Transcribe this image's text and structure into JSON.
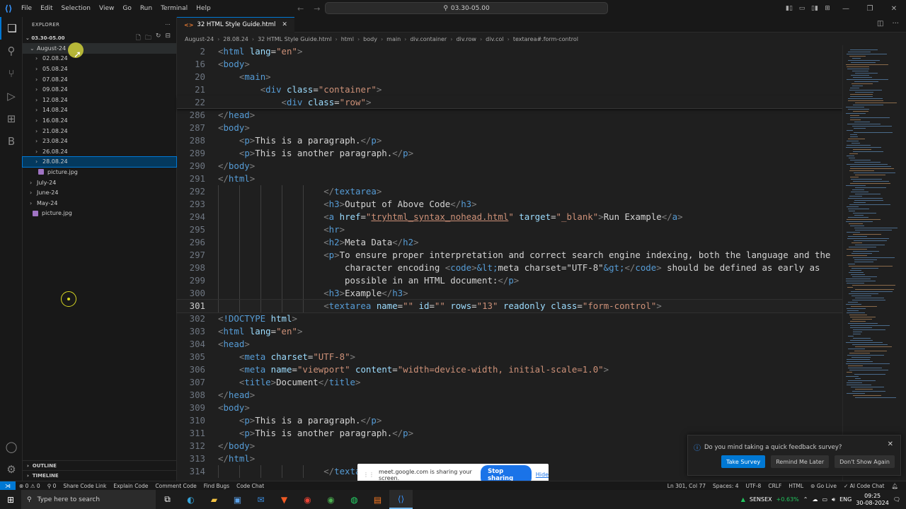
{
  "titlebar": {
    "menu": [
      "File",
      "Edit",
      "Selection",
      "View",
      "Go",
      "Run",
      "Terminal",
      "Help"
    ],
    "search_text": "03.30-05.00"
  },
  "sidebar": {
    "header": "EXPLORER",
    "root_folder": "03.30-05.00",
    "tree": [
      {
        "label": "August-24",
        "level": 0,
        "type": "folder",
        "open": true
      },
      {
        "label": "02.08.24",
        "level": 1,
        "type": "folder"
      },
      {
        "label": "05.08.24",
        "level": 1,
        "type": "folder"
      },
      {
        "label": "07.08.24",
        "level": 1,
        "type": "folder"
      },
      {
        "label": "09.08.24",
        "level": 1,
        "type": "folder"
      },
      {
        "label": "12.08.24",
        "level": 1,
        "type": "folder"
      },
      {
        "label": "14.08.24",
        "level": 1,
        "type": "folder"
      },
      {
        "label": "16.08.24",
        "level": 1,
        "type": "folder"
      },
      {
        "label": "21.08.24",
        "level": 1,
        "type": "folder"
      },
      {
        "label": "23.08.24",
        "level": 1,
        "type": "folder"
      },
      {
        "label": "26.08.24",
        "level": 1,
        "type": "folder"
      },
      {
        "label": "28.08.24",
        "level": 1,
        "type": "folder",
        "selected": true
      },
      {
        "label": "picture.jpg",
        "level": 1,
        "type": "file"
      },
      {
        "label": "July-24",
        "level": 0,
        "type": "folder"
      },
      {
        "label": "June-24",
        "level": 0,
        "type": "folder"
      },
      {
        "label": "May-24",
        "level": 0,
        "type": "folder"
      },
      {
        "label": "picture.jpg",
        "level": 0,
        "type": "file"
      }
    ],
    "outline": "OUTLINE",
    "timeline": "TIMELINE"
  },
  "editor": {
    "tab_label": "32 HTML Style Guide.html",
    "breadcrumb": [
      "August-24",
      "28.08.24",
      "32 HTML Style Guide.html",
      "html",
      "body",
      "main",
      "div.container",
      "div.row",
      "div.col",
      "textarea#.form-control"
    ]
  },
  "code_lines": [
    {
      "n": "2",
      "html": "<span class='t-br'>&lt;</span><span class='t-tag'>html</span> <span class='t-attr'>lang</span><span class='t-txt'>=</span><span class='t-val'>\"en\"</span><span class='t-br'>&gt;</span>",
      "sticky": true
    },
    {
      "n": "16",
      "html": "<span class='t-br'>&lt;</span><span class='t-tag'>body</span><span class='t-br'>&gt;</span>",
      "sticky": true
    },
    {
      "n": "20",
      "html": "    <span class='t-br'>&lt;</span><span class='t-tag'>main</span><span class='t-br'>&gt;</span>",
      "sticky": true
    },
    {
      "n": "21",
      "html": "        <span class='t-br'>&lt;</span><span class='t-tag'>div</span> <span class='t-attr'>class</span><span class='t-txt'>=</span><span class='t-val'>\"container\"</span><span class='t-br'>&gt;</span>",
      "sticky": true
    },
    {
      "n": "22",
      "html": "            <span class='t-br'>&lt;</span><span class='t-tag'>div</span> <span class='t-attr'>class</span><span class='t-txt'>=</span><span class='t-val'>\"row\"</span><span class='t-br'>&gt;</span>",
      "sticky": true,
      "last_sticky": true
    },
    {
      "n": "286",
      "html": "<span class='t-br'>&lt;/</span><span class='t-tag'>head</span><span class='t-br'>&gt;</span>"
    },
    {
      "n": "287",
      "html": "<span class='t-br'>&lt;</span><span class='t-tag'>body</span><span class='t-br'>&gt;</span>"
    },
    {
      "n": "288",
      "html": "    <span class='t-br'>&lt;</span><span class='t-tag'>p</span><span class='t-br'>&gt;</span><span class='t-txt'>This is a paragraph.</span><span class='t-br'>&lt;/</span><span class='t-tag'>p</span><span class='t-br'>&gt;</span>"
    },
    {
      "n": "289",
      "html": "    <span class='t-br'>&lt;</span><span class='t-tag'>p</span><span class='t-br'>&gt;</span><span class='t-txt'>This is another paragraph.</span><span class='t-br'>&lt;/</span><span class='t-tag'>p</span><span class='t-br'>&gt;</span>"
    },
    {
      "n": "290",
      "html": "<span class='t-br'>&lt;/</span><span class='t-tag'>body</span><span class='t-br'>&gt;</span>"
    },
    {
      "n": "291",
      "html": "<span class='t-br'>&lt;/</span><span class='t-tag'>html</span><span class='t-br'>&gt;</span>"
    },
    {
      "n": "292",
      "html": "                    <span class='t-br'>&lt;/</span><span class='t-tag'>textarea</span><span class='t-br'>&gt;</span>",
      "guides": true
    },
    {
      "n": "293",
      "html": "                    <span class='t-br'>&lt;</span><span class='t-tag'>h3</span><span class='t-br'>&gt;</span><span class='t-txt'>Output of Above Code</span><span class='t-br'>&lt;/</span><span class='t-tag'>h3</span><span class='t-br'>&gt;</span>",
      "guides": true
    },
    {
      "n": "294",
      "html": "                    <span class='t-br'>&lt;</span><span class='t-tag'>a</span> <span class='t-attr'>href</span><span class='t-txt'>=</span><span class='t-val'>\"<u>tryhtml_syntax_nohead.html</u>\"</span> <span class='t-attr'>target</span><span class='t-txt'>=</span><span class='t-val'>\"_blank\"</span><span class='t-br'>&gt;</span><span class='t-txt'>Run Example</span><span class='t-br'>&lt;/</span><span class='t-tag'>a</span><span class='t-br'>&gt;</span>",
      "guides": true
    },
    {
      "n": "295",
      "html": "                    <span class='t-br'>&lt;</span><span class='t-tag'>hr</span><span class='t-br'>&gt;</span>",
      "guides": true
    },
    {
      "n": "296",
      "html": "                    <span class='t-br'>&lt;</span><span class='t-tag'>h2</span><span class='t-br'>&gt;</span><span class='t-txt'>Meta Data</span><span class='t-br'>&lt;/</span><span class='t-tag'>h2</span><span class='t-br'>&gt;</span>",
      "guides": true
    },
    {
      "n": "297",
      "html": "                    <span class='t-br'>&lt;</span><span class='t-tag'>p</span><span class='t-br'>&gt;</span><span class='t-txt'>To ensure proper interpretation and correct search engine indexing, both the language and the</span>",
      "guides": true
    },
    {
      "n": "298",
      "html": "                        <span class='t-txt'>character encoding </span><span class='t-br'>&lt;</span><span class='t-tag'>code</span><span class='t-br'>&gt;</span><span class='t-ent'>&amp;lt;</span><span class='t-txt'>meta charset=\"UTF-8\"</span><span class='t-ent'>&amp;gt;</span><span class='t-br'>&lt;/</span><span class='t-tag'>code</span><span class='t-br'>&gt;</span><span class='t-txt'> should be defined as early as</span>",
      "guides": true
    },
    {
      "n": "299",
      "html": "                        <span class='t-txt'>possible in an HTML document:</span><span class='t-br'>&lt;/</span><span class='t-tag'>p</span><span class='t-br'>&gt;</span>",
      "guides": true
    },
    {
      "n": "300",
      "html": "                    <span class='t-br'>&lt;</span><span class='t-tag'>h3</span><span class='t-br'>&gt;</span><span class='t-txt'>Example</span><span class='t-br'>&lt;/</span><span class='t-tag'>h3</span><span class='t-br'>&gt;</span>",
      "guides": true
    },
    {
      "n": "301",
      "html": "                    <span class='t-br'>&lt;</span><span class='t-tag'>textarea</span> <span class='t-attr'>name</span><span class='t-txt'>=</span><span class='t-val'>\"\"</span> <span class='t-attr'>id</span><span class='t-txt'>=</span><span class='t-val'>\"\"</span> <span class='t-attr'>rows</span><span class='t-txt'>=</span><span class='t-val'>\"13\"</span> <span class='t-attr'>readonly</span> <span class='t-attr'>class</span><span class='t-txt'>=</span><span class='t-val'>\"form-control\"</span><span class='t-br'>&gt;</span>",
      "guides": true,
      "current": true
    },
    {
      "n": "302",
      "html": "<span class='t-br'>&lt;</span><span class='t-tag'>!DOCTYPE</span> <span class='t-attr'>html</span><span class='t-br'>&gt;</span>"
    },
    {
      "n": "303",
      "html": "<span class='t-br'>&lt;</span><span class='t-tag'>html</span> <span class='t-attr'>lang</span><span class='t-txt'>=</span><span class='t-val'>\"en\"</span><span class='t-br'>&gt;</span>"
    },
    {
      "n": "304",
      "html": "<span class='t-br'>&lt;</span><span class='t-tag'>head</span><span class='t-br'>&gt;</span>"
    },
    {
      "n": "305",
      "html": "    <span class='t-br'>&lt;</span><span class='t-tag'>meta</span> <span class='t-attr'>charset</span><span class='t-txt'>=</span><span class='t-val'>\"UTF-8\"</span><span class='t-br'>&gt;</span>"
    },
    {
      "n": "306",
      "html": "    <span class='t-br'>&lt;</span><span class='t-tag'>meta</span> <span class='t-attr'>name</span><span class='t-txt'>=</span><span class='t-val'>\"viewport\"</span> <span class='t-attr'>content</span><span class='t-txt'>=</span><span class='t-val'>\"width=device-width, initial-scale=1.0\"</span><span class='t-br'>&gt;</span>"
    },
    {
      "n": "307",
      "html": "    <span class='t-br'>&lt;</span><span class='t-tag'>title</span><span class='t-br'>&gt;</span><span class='t-txt'>Document</span><span class='t-br'>&lt;/</span><span class='t-tag'>title</span><span class='t-br'>&gt;</span>"
    },
    {
      "n": "308",
      "html": "<span class='t-br'>&lt;/</span><span class='t-tag'>head</span><span class='t-br'>&gt;</span>"
    },
    {
      "n": "309",
      "html": "<span class='t-br'>&lt;</span><span class='t-tag'>body</span><span class='t-br'>&gt;</span>"
    },
    {
      "n": "310",
      "html": "    <span class='t-br'>&lt;</span><span class='t-tag'>p</span><span class='t-br'>&gt;</span><span class='t-txt'>This is a paragraph.</span><span class='t-br'>&lt;/</span><span class='t-tag'>p</span><span class='t-br'>&gt;</span>"
    },
    {
      "n": "311",
      "html": "    <span class='t-br'>&lt;</span><span class='t-tag'>p</span><span class='t-br'>&gt;</span><span class='t-txt'>This is another paragraph.</span><span class='t-br'>&lt;/</span><span class='t-tag'>p</span><span class='t-br'>&gt;</span>"
    },
    {
      "n": "312",
      "html": "<span class='t-br'>&lt;/</span><span class='t-tag'>body</span><span class='t-br'>&gt;</span>"
    },
    {
      "n": "313",
      "html": "<span class='t-br'>&lt;/</span><span class='t-tag'>html</span><span class='t-br'>&gt;</span>"
    },
    {
      "n": "314",
      "html": "                    <span class='t-br'>&lt;/</span><span class='t-tag'>texta</span>",
      "guides": true
    }
  ],
  "survey": {
    "message": "Do you mind taking a quick feedback survey?",
    "take": "Take Survey",
    "remind": "Remind Me Later",
    "dont": "Don't Show Again"
  },
  "share": {
    "message": "meet.google.com is sharing your screen.",
    "stop": "Stop sharing",
    "hide": "Hide"
  },
  "statusbar": {
    "left": [
      "⊗ 0 ⚠ 0",
      "⚲ 0",
      "Share Code Link",
      "Explain Code",
      "Comment Code",
      "Find Bugs",
      "Code Chat"
    ],
    "right": [
      "Ln 301, Col 77",
      "Spaces: 4",
      "UTF-8",
      "CRLF",
      "HTML",
      "⊚ Go Live",
      "✓ AI Code Chat"
    ]
  },
  "taskbar": {
    "search_placeholder": "Type here to search",
    "sensex_label": "SENSEX",
    "sensex_change": "+0.63%",
    "language": "ENG",
    "time": "09:25",
    "date": "30-08-2024"
  }
}
